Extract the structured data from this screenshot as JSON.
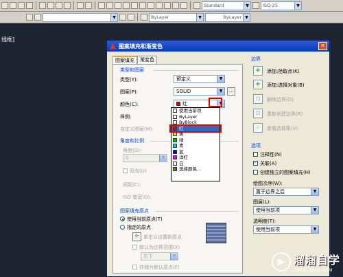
{
  "toolbar1": {
    "text_style": "Standard",
    "dim_style": "ISO-25"
  },
  "toolbar2": {
    "layer_field": "ByLayer",
    "linetype_field": "ByLayer"
  },
  "canvas": {
    "viewport_label": "线框]"
  },
  "dialog": {
    "title": "图案填充和渐变色",
    "close_glyph": "✕",
    "tabs": [
      "图案填充",
      "渐变色"
    ],
    "type_group": {
      "heading": "类型和图案",
      "type_label": "类型(Y):",
      "type_value": "预定义",
      "pattern_label": "图案(P):",
      "pattern_value": "SOLID",
      "pattern_btn": "...",
      "color_label": "颜色(C):",
      "color_value": "红",
      "color_swatch": "#e00000",
      "sample_label": "样例:",
      "custom_label": "自定义图案(M):"
    },
    "angle_group": {
      "heading": "角度和比例",
      "angle_label": "角度(G):",
      "angle_value": "0",
      "double_label": "双向(U)",
      "spacing_label": "间距(C):",
      "iso_label": "ISO 笔宽(O):"
    },
    "origin_group": {
      "heading": "图案填充原点",
      "use_current": "使用当前原点(T)",
      "specified": "指定的原点",
      "click_set": "单击以设置新原点",
      "default_extent": "默认为边界范围(X)",
      "lower_left": "左下",
      "store_default": "存储为默认原点(F)"
    },
    "color_dropdown": {
      "items": [
        {
          "label": "使用当前项",
          "swatch": "#ffffff"
        },
        {
          "label": "ByLayer",
          "swatch": "#ffffff"
        },
        {
          "label": "ByBlock",
          "swatch": "#ffffff"
        },
        {
          "label": "红",
          "swatch": "#e00000",
          "selected": true
        },
        {
          "label": "黄",
          "swatch": "#f0e000"
        },
        {
          "label": "绿",
          "swatch": "#00c000"
        },
        {
          "label": "青",
          "swatch": "#00d0d0"
        },
        {
          "label": "蓝",
          "swatch": "#0000e0"
        },
        {
          "label": "洋红",
          "swatch": "#e000e0"
        },
        {
          "label": "白",
          "swatch": "#ffffff"
        },
        {
          "label": "选择颜色...",
          "swatch": "#808080"
        }
      ]
    },
    "boundary": {
      "heading": "边界",
      "add_pick": "添加:拾取点(K)",
      "add_select": "添加:选择对象(B)",
      "remove": "删除边界(D)",
      "recreate": "重新创建边界(R)",
      "view": "查看选择集(V)"
    },
    "options": {
      "heading": "选项",
      "annotative": "注释性(N)",
      "associative": "关联(A)",
      "separate": "创建独立的图案填充(H)",
      "draw_order_label": "绘图次序(W):",
      "draw_order_value": "置于边界之后",
      "layer_label": "图层(L):",
      "layer_value": "使用当前项",
      "transparency_label": "透明度(T):",
      "transparency_value": "使用当前项"
    }
  },
  "watermark": {
    "title": "溜溜自学",
    "url": "ZIXUE.3D66.COM"
  }
}
